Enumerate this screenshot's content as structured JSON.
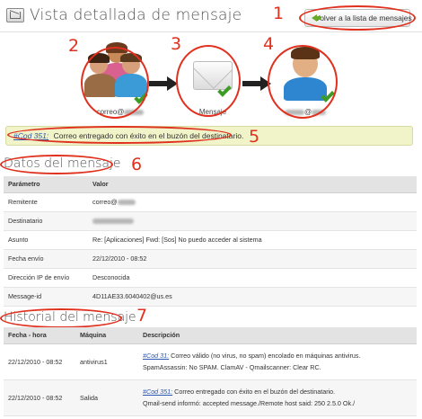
{
  "header": {
    "title": "Vista detallada de mensaje",
    "back_button": "Volver a la lista de mensajes"
  },
  "annotations": [
    "1",
    "2",
    "3",
    "4",
    "5",
    "6",
    "7"
  ],
  "flow": {
    "sender_caption_prefix": "correo@",
    "message_caption": "Mensaje",
    "recipient_caption_suffix": "@",
    "colors": {
      "check": "#3d9b26",
      "annotation": "#e0301e"
    }
  },
  "status": {
    "code": "#Cod 351:",
    "text": "Correo entregado con éxito en el buzón del destinatario."
  },
  "datos": {
    "title": "Datos del mensaje",
    "columns": [
      "Parámetro",
      "Valor"
    ],
    "rows": [
      {
        "param": "Remitente",
        "value": "correo@"
      },
      {
        "param": "Destinatario",
        "value": ""
      },
      {
        "param": "Asunto",
        "value": "Re: [Aplicaciones] Fwd: [Sos] No puedo acceder al sistema"
      },
      {
        "param": "Fecha envío",
        "value": "22/12/2010 - 08:52"
      },
      {
        "param": "Dirección IP de envío",
        "value": "Desconocida"
      },
      {
        "param": "Message-id",
        "value": "4D11AE33.6040402@us.es"
      }
    ]
  },
  "historial": {
    "title": "Historial del mensaje",
    "columns": [
      "Fecha - hora",
      "Máquina",
      "Descripción"
    ],
    "rows": [
      {
        "fecha": "22/12/2010 - 08:52",
        "maquina": "antivirus1",
        "code": "#Cod 31:",
        "line1": "Correo válido (no virus, no spam) encolado en máquinas antivirus.",
        "line2": "SpamAssassin: No SPAM. ClamAV - Qmailscanner: Clear RC."
      },
      {
        "fecha": "22/12/2010 - 08:52",
        "maquina": "Salida",
        "code": "#Cod 351:",
        "line1": "Correo entregado con éxito en el buzón del destinatario.",
        "line2": "Qmail-send informó: accepted message./Remote host said: 250 2.5.0 Ok./"
      }
    ]
  }
}
